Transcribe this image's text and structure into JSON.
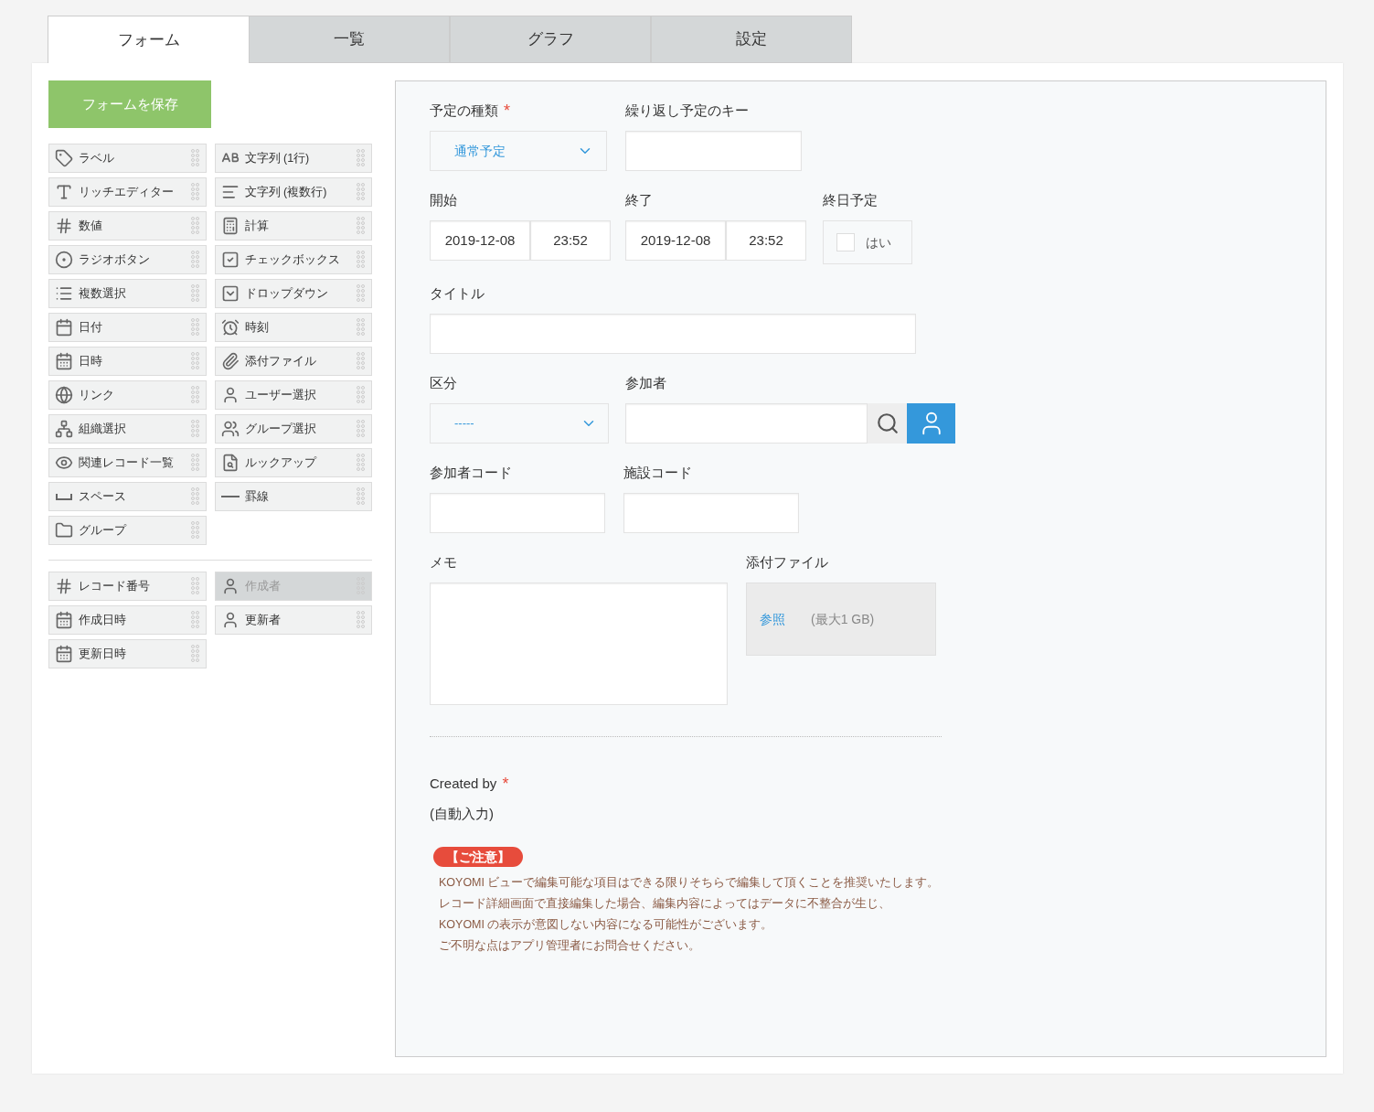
{
  "tabs": [
    {
      "label": "フォーム",
      "selected": true
    },
    {
      "label": "一覧",
      "selected": false
    },
    {
      "label": "グラフ",
      "selected": false
    },
    {
      "label": "設定",
      "selected": false
    }
  ],
  "save_button": "フォームを保存",
  "palette": {
    "groups": [
      [
        {
          "label": "ラベル",
          "kind": "tag",
          "disabled": false
        },
        {
          "label": "文字列 (1行)",
          "kind": "abc",
          "disabled": false
        },
        {
          "label": "リッチエディター",
          "kind": "rich",
          "disabled": false
        },
        {
          "label": "文字列 (複数行)",
          "kind": "multiline",
          "disabled": false
        },
        {
          "label": "数値",
          "kind": "number",
          "disabled": false
        },
        {
          "label": "計算",
          "kind": "calc",
          "disabled": false
        },
        {
          "label": "ラジオボタン",
          "kind": "radio",
          "disabled": false
        },
        {
          "label": "チェックボックス",
          "kind": "checkbox",
          "disabled": false
        },
        {
          "label": "複数選択",
          "kind": "list",
          "disabled": false
        },
        {
          "label": "ドロップダウン",
          "kind": "dropdown",
          "disabled": false
        },
        {
          "label": "日付",
          "kind": "date",
          "disabled": false
        },
        {
          "label": "時刻",
          "kind": "clock",
          "disabled": false
        },
        {
          "label": "日時",
          "kind": "datetime",
          "disabled": false
        },
        {
          "label": "添付ファイル",
          "kind": "attach",
          "disabled": false
        },
        {
          "label": "リンク",
          "kind": "globe",
          "disabled": false
        },
        {
          "label": "ユーザー選択",
          "kind": "user",
          "disabled": false
        },
        {
          "label": "組織選択",
          "kind": "org",
          "disabled": false
        },
        {
          "label": "グループ選択",
          "kind": "users",
          "disabled": false
        },
        {
          "label": "関連レコード一覧",
          "kind": "related",
          "disabled": false
        },
        {
          "label": "ルックアップ",
          "kind": "lookup",
          "disabled": false
        },
        {
          "label": "スペース",
          "kind": "space",
          "disabled": false
        },
        {
          "label": "罫線",
          "kind": "line",
          "disabled": false
        },
        {
          "label": "グループ",
          "kind": "group",
          "disabled": false
        }
      ],
      [
        {
          "label": "レコード番号",
          "kind": "number",
          "disabled": false
        },
        {
          "label": "作成者",
          "kind": "user",
          "disabled": true
        },
        {
          "label": "作成日時",
          "kind": "datetime",
          "disabled": false
        },
        {
          "label": "更新者",
          "kind": "user",
          "disabled": false
        },
        {
          "label": "更新日時",
          "kind": "datetime",
          "disabled": false
        }
      ]
    ]
  },
  "form": {
    "schedule_type": {
      "label": "予定の種類",
      "required": "*",
      "value": "通常予定"
    },
    "recurrence_key": {
      "label": "繰り返し予定のキー"
    },
    "start": {
      "label": "開始",
      "date": "2019-12-08",
      "time": "23:52"
    },
    "end": {
      "label": "終了",
      "date": "2019-12-08",
      "time": "23:52"
    },
    "all_day": {
      "label": "終日予定",
      "option": "はい",
      "checked": false
    },
    "title": {
      "label": "タイトル"
    },
    "category": {
      "label": "区分",
      "value": "-----"
    },
    "participants": {
      "label": "参加者"
    },
    "participant_code": {
      "label": "参加者コード"
    },
    "facility_code": {
      "label": "施設コード"
    },
    "memo": {
      "label": "メモ"
    },
    "attachment": {
      "label": "添付ファイル",
      "browse": "参照",
      "limit": "(最大1 GB)"
    },
    "created_by": {
      "label": "Created by",
      "required": "*",
      "value": "(自動入力)"
    },
    "notice": {
      "badge": "【ご注意】",
      "lines": [
        "KOYOMI ビューで編集可能な項目はできる限りそちらで編集して頂くことを推奨いたします。",
        "レコード詳細画面で直接編集した場合、編集内容によってはデータに不整合が生じ、",
        "KOYOMI の表示が意図しない内容になる可能性がございます。",
        "ご不明な点はアプリ管理者にお問合せください。"
      ]
    }
  }
}
